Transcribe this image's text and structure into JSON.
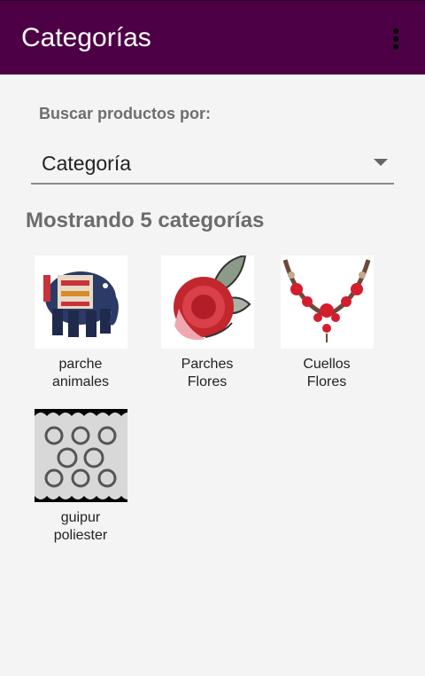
{
  "appbar": {
    "title": "Categorías",
    "menu_icon": "more-vert-icon"
  },
  "search": {
    "label": "Buscar productos por:",
    "selected": "Categoría"
  },
  "results": {
    "heading": "Mostrando 5 categorías"
  },
  "categories": [
    {
      "label": "parche\nanimales",
      "image": "elephant-patch"
    },
    {
      "label": "Parches\nFlores",
      "image": "rose-patch"
    },
    {
      "label": "Cuellos\nFlores",
      "image": "floral-collar"
    },
    {
      "label": "guipur\npoliester",
      "image": "guipure-lace"
    }
  ]
}
